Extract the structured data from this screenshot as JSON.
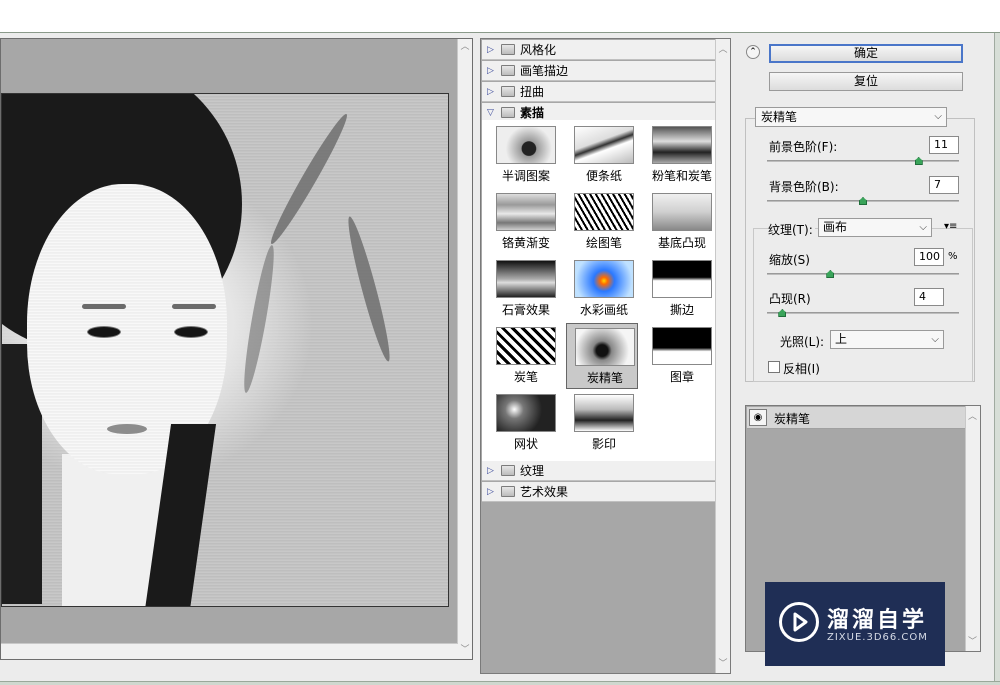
{
  "gallery": {
    "categories_top": [
      {
        "label": "风格化",
        "expanded": false
      },
      {
        "label": "画笔描边",
        "expanded": false
      },
      {
        "label": "扭曲",
        "expanded": false
      },
      {
        "label": "素描",
        "expanded": true
      }
    ],
    "thumbnails": [
      {
        "label": "半调图案"
      },
      {
        "label": "便条纸"
      },
      {
        "label": "粉笔和炭笔"
      },
      {
        "label": "铬黄渐变"
      },
      {
        "label": "绘图笔"
      },
      {
        "label": "基底凸现"
      },
      {
        "label": "石膏效果"
      },
      {
        "label": "水彩画纸"
      },
      {
        "label": "撕边"
      },
      {
        "label": "炭笔"
      },
      {
        "label": "炭精笔",
        "selected": true
      },
      {
        "label": "图章"
      },
      {
        "label": "网状"
      },
      {
        "label": "影印"
      }
    ],
    "categories_bottom": [
      {
        "label": "纹理",
        "expanded": false
      },
      {
        "label": "艺术效果",
        "expanded": false
      }
    ]
  },
  "settings": {
    "ok_label": "确定",
    "reset_label": "复位",
    "filter_selected": "炭精笔",
    "foreground_label": "前景色阶(F):",
    "foreground_value": "11",
    "foreground_level": 0.79,
    "background_label": "背景色阶(B):",
    "background_value": "7",
    "background_level": 0.5,
    "texture_label": "纹理(T):",
    "texture_value": "画布",
    "scale_label": "缩放(S)",
    "scale_value": "100",
    "scale_unit": "%",
    "scale_level": 0.33,
    "relief_label": "凸现(R)",
    "relief_value": "4",
    "relief_level": 0.08,
    "light_label": "光照(L):",
    "light_value": "上",
    "invert_label": "反相(I)",
    "invert_checked": false
  },
  "layers": {
    "items": [
      {
        "label": "炭精笔",
        "visible": true
      }
    ]
  },
  "watermark": {
    "title": "溜溜自学",
    "url": "ZIXUE.3D66.COM"
  },
  "colors": {
    "panel_bg": "#a7a7a7",
    "primary_border": "#4a76c9",
    "slider_thumb": "#3aa45a",
    "watermark_bg": "#1f2e55"
  }
}
